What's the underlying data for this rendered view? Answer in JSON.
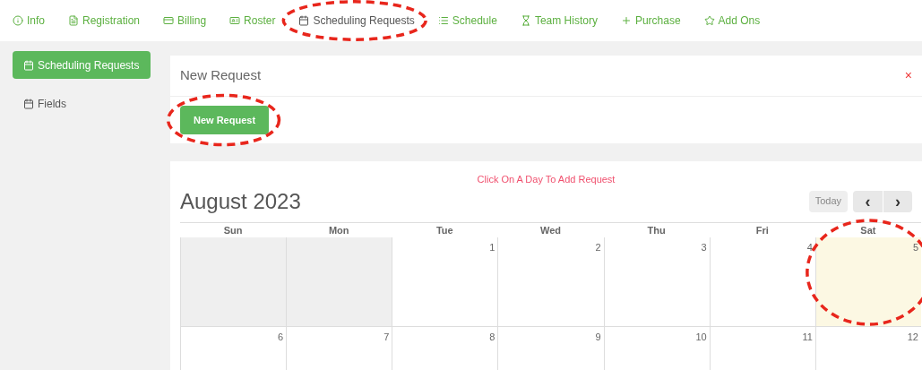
{
  "tabs": [
    {
      "label": "Info",
      "selected": false,
      "circled": false
    },
    {
      "label": "Registration",
      "selected": false,
      "circled": false
    },
    {
      "label": "Billing",
      "selected": false,
      "circled": false
    },
    {
      "label": "Roster",
      "selected": false,
      "circled": false
    },
    {
      "label": "Scheduling Requests",
      "selected": true,
      "circled": true
    },
    {
      "label": "Schedule",
      "selected": false,
      "circled": false
    },
    {
      "label": "Team History",
      "selected": false,
      "circled": false
    },
    {
      "label": "Purchase",
      "selected": false,
      "circled": false
    },
    {
      "label": "Add Ons",
      "selected": false,
      "circled": false
    }
  ],
  "sidebar": {
    "items": [
      {
        "label": "Scheduling Requests",
        "selected": true
      },
      {
        "label": "Fields",
        "selected": false
      }
    ]
  },
  "panel": {
    "title": "New Request",
    "close": "×",
    "button": {
      "label": "New Request",
      "circled": true
    }
  },
  "calendar": {
    "hint": "Click On A Day To Add Request",
    "title": "August 2023",
    "today_button": "Today",
    "prev": "‹",
    "next": "›",
    "weekdays": [
      "Sun",
      "Mon",
      "Tue",
      "Wed",
      "Thu",
      "Fri",
      "Sat"
    ],
    "weeks": [
      [
        {
          "other_month": true,
          "today": false,
          "circled": false
        },
        {
          "other_month": true,
          "today": false,
          "circled": false
        },
        {
          "label": "1",
          "other_month": false,
          "today": false,
          "circled": false
        },
        {
          "label": "2",
          "other_month": false,
          "today": false,
          "circled": false
        },
        {
          "label": "3",
          "other_month": false,
          "today": false,
          "circled": false
        },
        {
          "label": "4",
          "other_month": false,
          "today": false,
          "circled": false
        },
        {
          "label": "5",
          "other_month": false,
          "today": true,
          "circled": true
        }
      ],
      [
        {
          "label": "6",
          "other_month": false,
          "today": false,
          "circled": false
        },
        {
          "label": "7",
          "other_month": false,
          "today": false,
          "circled": false
        },
        {
          "label": "8",
          "other_month": false,
          "today": false,
          "circled": false
        },
        {
          "label": "9",
          "other_month": false,
          "today": false,
          "circled": false
        },
        {
          "label": "10",
          "other_month": false,
          "today": false,
          "circled": false
        },
        {
          "label": "11",
          "other_month": false,
          "today": false,
          "circled": false
        },
        {
          "label": "12",
          "other_month": false,
          "today": false,
          "circled": false
        }
      ]
    ]
  }
}
